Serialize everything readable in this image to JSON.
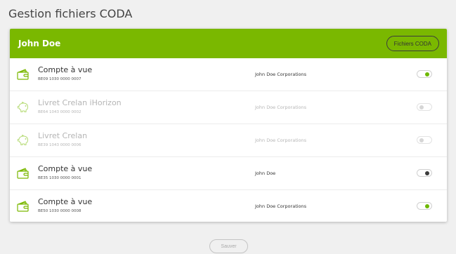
{
  "page": {
    "title": "Gestion fichiers CODA"
  },
  "card": {
    "title": "John Doe",
    "coda_button_label": "Fichiers CODA"
  },
  "accounts": [
    {
      "name": "Compte à vue",
      "iban": "BE09 1030 0000 0007",
      "owner": "John Doe Corporations",
      "icon": "wallet-icon",
      "state": "on",
      "enabled": true
    },
    {
      "name": "Livret Crelan iHorizon",
      "iban": "BE64 1043 0000 0002",
      "owner": "John Doe Corporations",
      "icon": "piggy-bank-icon",
      "state": "off",
      "enabled": false
    },
    {
      "name": "Livret Crelan",
      "iban": "BE39 1043 0000 0006",
      "owner": "John Doe Corporations",
      "icon": "piggy-bank-icon",
      "state": "off",
      "enabled": false
    },
    {
      "name": "Compte à vue",
      "iban": "BE35 1030 0000 0001",
      "owner": "John Doe",
      "icon": "wallet-icon",
      "state": "off",
      "enabled": true
    },
    {
      "name": "Compte à vue",
      "iban": "BE50 1030 0000 0008",
      "owner": "John Doe Corporations",
      "icon": "wallet-icon",
      "state": "on",
      "enabled": true
    }
  ],
  "footer": {
    "save_label": "Sauver"
  },
  "colors": {
    "accent": "#7ab800",
    "toggle_on": "#6eb800",
    "toggle_off": "#3c3c3c"
  }
}
